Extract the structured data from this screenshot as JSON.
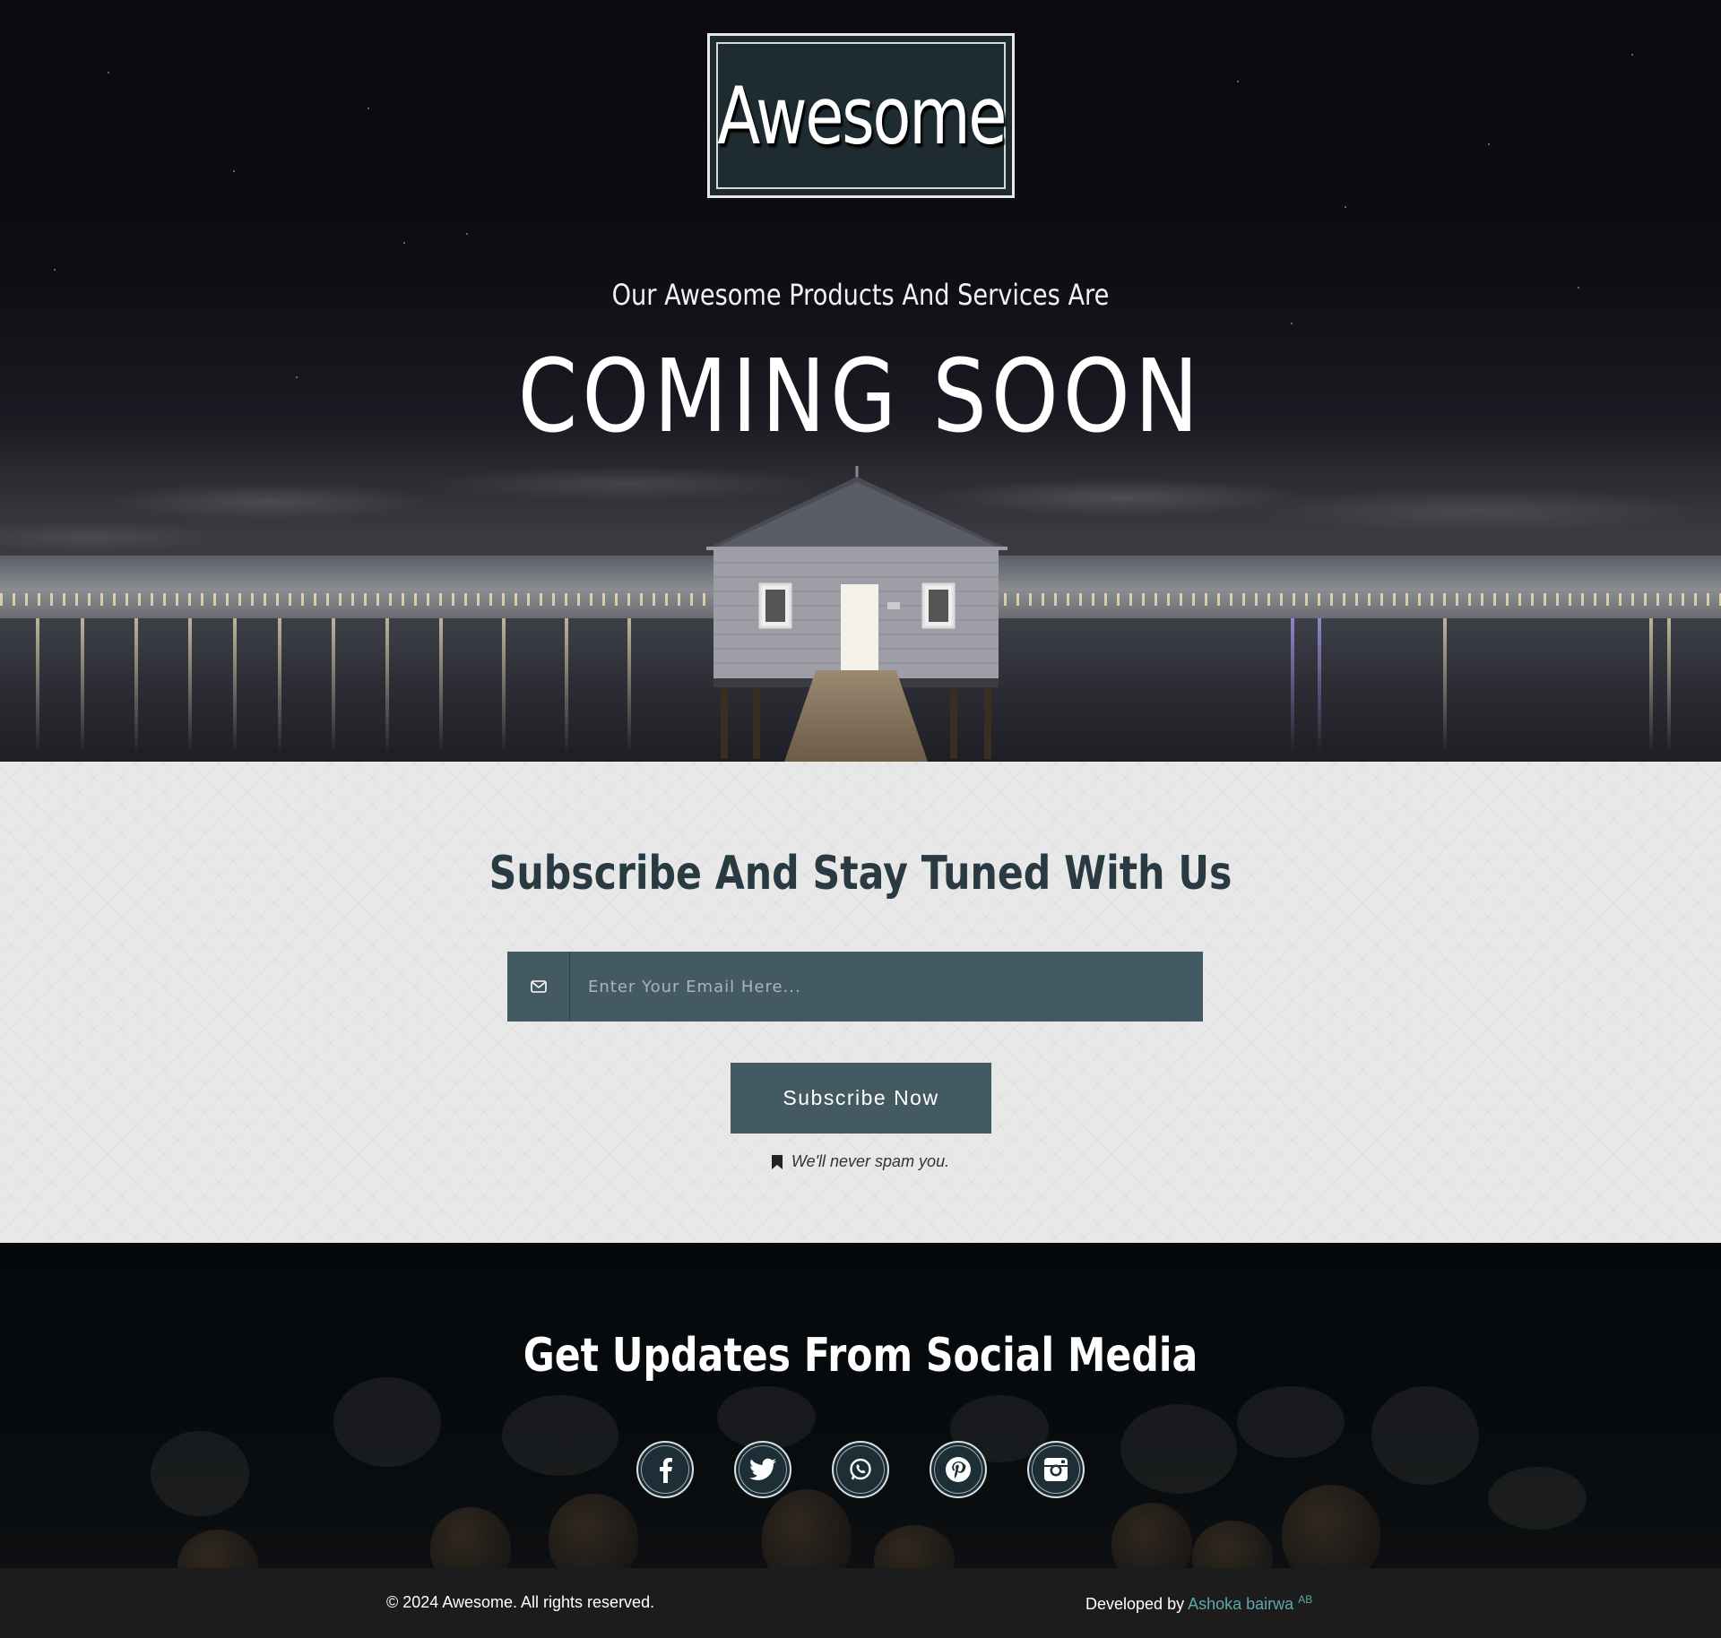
{
  "hero": {
    "logo": "Awesome",
    "subtitle": "Our Awesome Products And Services Are",
    "title": "COMING SOON"
  },
  "subscribe": {
    "title": "Subscribe And Stay Tuned With Us",
    "email_icon": "envelope-icon",
    "email_placeholder": "Enter Your Email Here...",
    "email_value": "",
    "button_label": "Subscribe Now",
    "note_icon": "bookmark-icon",
    "note": "We'll never spam you."
  },
  "social": {
    "title": "Get Updates From Social Media",
    "icons": [
      "facebook-icon",
      "twitter-icon",
      "whatsapp-icon",
      "pinterest-icon",
      "instagram-icon"
    ]
  },
  "footer": {
    "copyright": "© 2024 Awesome. All rights reserved.",
    "developed_by": "Developed by",
    "developer": "Ashoka bairwa",
    "developer_badge": "AB"
  },
  "colors": {
    "accent": "#435a62",
    "logo_bg": "#1e2b31",
    "link": "#5fa8a8",
    "footer_bg": "#1c1c1c"
  }
}
